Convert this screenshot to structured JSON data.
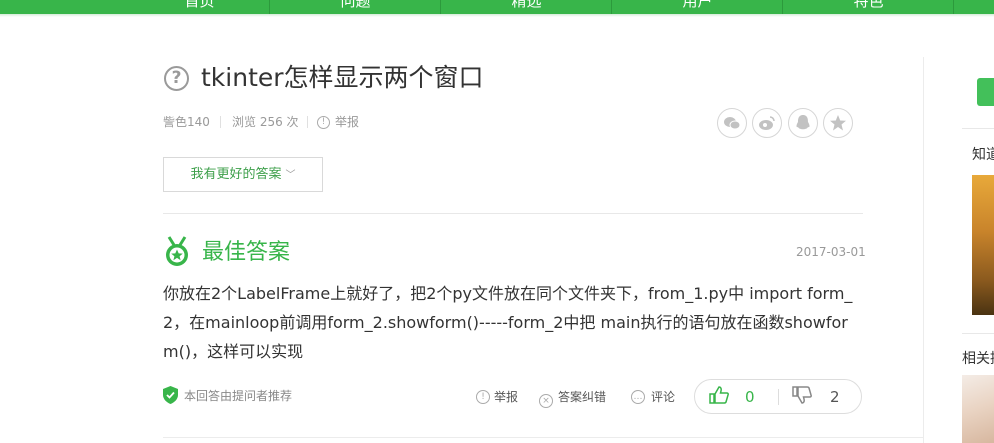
{
  "nav": {
    "items": [
      "首页",
      "问题",
      "精选",
      "用户",
      "特色"
    ]
  },
  "question": {
    "title": "tkinter怎样显示两个窗口",
    "author": "訾色140",
    "views": "浏览 256 次",
    "report": "举报"
  },
  "share": {
    "icons": [
      "wechat-icon",
      "weibo-icon",
      "qq-icon",
      "favorite-star-icon"
    ]
  },
  "better_answer_label": "我有更好的答案",
  "best": {
    "heading": "最佳答案",
    "date": "2017-03-01",
    "text": "你放在2个LabelFrame上就好了，把2个py文件放在同个文件夹下，from_1.py中 import form_2，在mainloop前调用form_2.showform()-----form_2中把 main执行的语句放在函数showform()，这样可以实现",
    "recommended_by": "本回答由提问者推荐"
  },
  "actions": {
    "report": "举报",
    "correct": "答案纠错",
    "comment": "评论"
  },
  "votes": {
    "up": "0",
    "down": "2"
  },
  "sidebar": {
    "heading1": "知道",
    "heading2": "相关推荐"
  },
  "colors": {
    "brand": "#38b54a"
  }
}
